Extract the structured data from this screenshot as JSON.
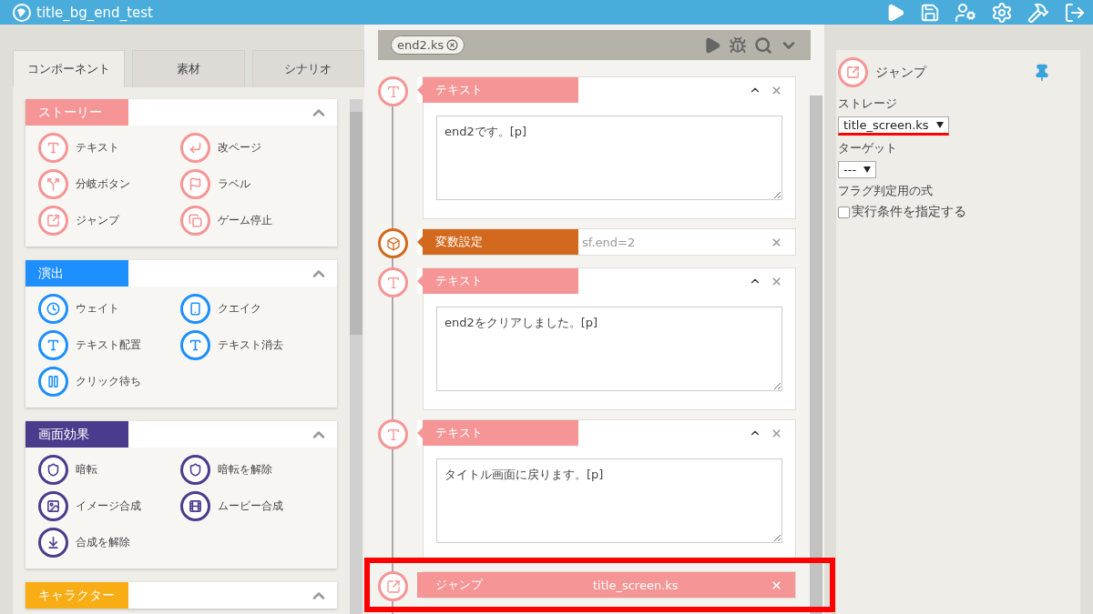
{
  "app": {
    "title": "title_bg_end_test"
  },
  "left_panel": {
    "tabs": [
      {
        "label": "コンポーネント",
        "selected": true
      },
      {
        "label": "素材",
        "selected": false
      },
      {
        "label": "シナリオ",
        "selected": false
      }
    ],
    "sections": [
      {
        "title": "ストーリー",
        "color": "#f59595",
        "expanded": true,
        "items": [
          "テキスト",
          "改ページ",
          "分岐ボタン",
          "ラベル",
          "ジャンプ",
          "ゲーム停止"
        ]
      },
      {
        "title": "演出",
        "color": "#1e8fff",
        "expanded": true,
        "items": [
          "ウェイト",
          "クエイク",
          "テキスト配置",
          "テキスト消去",
          "クリック待ち"
        ]
      },
      {
        "title": "画面効果",
        "color": "#4b3b8c",
        "expanded": true,
        "items": [
          "暗転",
          "暗転を解除",
          "イメージ合成",
          "ムービー合成",
          "合成を解除"
        ]
      },
      {
        "title": "キャラクター",
        "color": "#f9ad14",
        "expanded": true
      }
    ]
  },
  "editor": {
    "file_tab": {
      "label": "end2.ks"
    },
    "items": [
      {
        "kind": "text",
        "label": "テキスト",
        "text": "end2です。[p]",
        "expanded": true,
        "highlighted": false
      },
      {
        "kind": "variable",
        "label": "変数設定",
        "value": "sf.end=2",
        "highlighted": false
      },
      {
        "kind": "text",
        "label": "テキスト",
        "text": "end2をクリアしました。[p]",
        "expanded": true,
        "highlighted": false
      },
      {
        "kind": "text",
        "label": "テキスト",
        "text": "タイトル画面に戻ります。[p]",
        "expanded": true,
        "highlighted": false
      },
      {
        "kind": "jump",
        "label": "ジャンプ",
        "value": "title_screen.ks",
        "highlighted": true
      }
    ]
  },
  "properties": {
    "title": "ジャンプ",
    "fields": [
      {
        "kind": "select",
        "label": "ストレージ",
        "value": "title_screen.ks",
        "highlighted": true
      },
      {
        "kind": "select",
        "label": "ターゲット",
        "value": "---",
        "highlighted": false
      },
      {
        "kind": "label",
        "label": "フラグ判定用の式"
      },
      {
        "kind": "checkbox",
        "label": "実行条件を指定する",
        "checked": false
      }
    ]
  }
}
